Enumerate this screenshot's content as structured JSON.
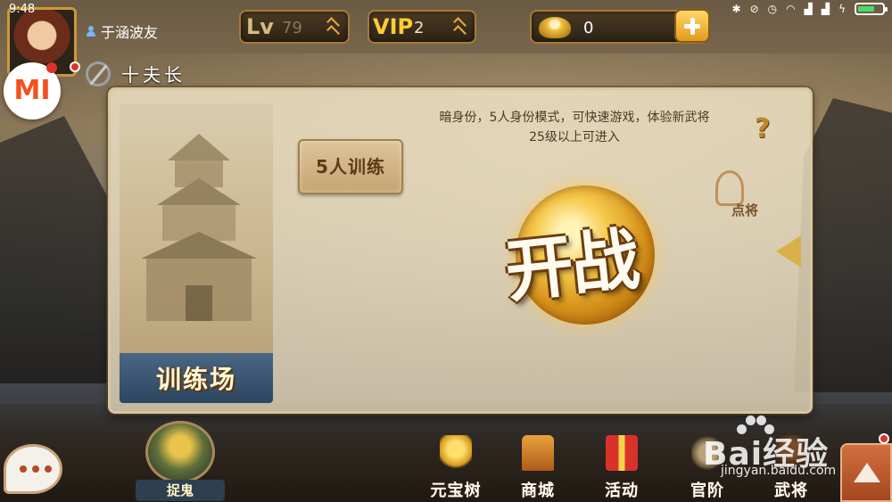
{
  "status_bar": {
    "time": "9:48",
    "icons": [
      "bluetooth-icon",
      "mute-icon",
      "alarm-icon",
      "wifi-icon",
      "signal-icon",
      "signal-icon",
      "charging-icon",
      "battery-icon"
    ]
  },
  "player": {
    "name": "于涵波友",
    "rank_title": "十夫长"
  },
  "level": {
    "label": "Lv",
    "value": "79"
  },
  "vip": {
    "label": "VIP",
    "value": "2"
  },
  "currency": {
    "gold": "0"
  },
  "mi_badge": {
    "label": "MI"
  },
  "panel": {
    "card_title": "训练场",
    "mode_button": "5人训练",
    "description_line1": "暗身份，5人身份模式，可快速游戏，体验新武将",
    "description_line2": "25级以上可进入",
    "help_label": "?",
    "helmet_label": "点将",
    "start_button": "开战"
  },
  "bottom_nav": {
    "ghost_label": "捉鬼",
    "items": [
      {
        "label": "元宝树",
        "icon": "money-tree-icon"
      },
      {
        "label": "商城",
        "icon": "shop-icon"
      },
      {
        "label": "活动",
        "icon": "gift-box-icon"
      },
      {
        "label": "官阶",
        "icon": "rank-icon"
      },
      {
        "label": "武将",
        "icon": "general-icon"
      }
    ]
  },
  "watermark": {
    "text": "Bai经验",
    "url": "jingyan.baidu.com"
  },
  "colors": {
    "accent_gold": "#e9a83a",
    "vip_yellow": "#ffcc33",
    "panel_bg": "#ece0c4",
    "card_label_bg": "#2c4560",
    "notification_red": "#e0302a"
  }
}
